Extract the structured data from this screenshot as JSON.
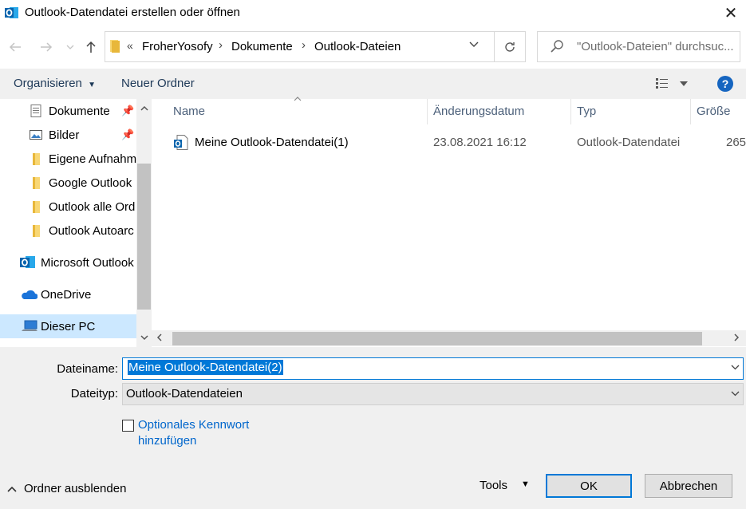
{
  "window": {
    "title": "Outlook-Datendatei erstellen oder öffnen",
    "close_glyph": "✕"
  },
  "address": {
    "overflow_chevron": "«",
    "breadcrumbs": [
      "FroherYosofy",
      "Dokumente",
      "Outlook-Dateien"
    ],
    "separator": "›",
    "search_placeholder": "\"Outlook-Dateien\" durchsuc..."
  },
  "toolbar": {
    "organize_label": "Organisieren",
    "new_folder_label": "Neuer Ordner",
    "help_label": "?"
  },
  "navpane": {
    "items": [
      {
        "label": "Dokumente",
        "icon": "documents-icon",
        "pinned": true
      },
      {
        "label": "Bilder",
        "icon": "pictures-icon",
        "pinned": true
      },
      {
        "label": "Eigene Aufnahm",
        "icon": "folder-icon",
        "pinned": false
      },
      {
        "label": "Google Outlook",
        "icon": "folder-icon",
        "pinned": false
      },
      {
        "label": "Outlook alle Ord",
        "icon": "folder-icon",
        "pinned": false
      },
      {
        "label": "Outlook Autoarc",
        "icon": "folder-icon",
        "pinned": false
      },
      {
        "label": "Microsoft Outlook",
        "icon": "outlook-icon",
        "pinned": false
      },
      {
        "label": "OneDrive",
        "icon": "onedrive-icon",
        "pinned": false
      },
      {
        "label": "Dieser PC",
        "icon": "pc-icon",
        "pinned": false,
        "selected": true
      }
    ]
  },
  "filelist": {
    "columns": [
      "Name",
      "Änderungsdatum",
      "Typ",
      "Größe"
    ],
    "rows": [
      {
        "name": "Meine Outlook-Datendatei(1)",
        "date": "23.08.2021 16:12",
        "type": "Outlook-Datendatei",
        "size": "265"
      }
    ]
  },
  "form": {
    "filename_label": "Dateiname:",
    "filename_value": "Meine Outlook-Datendatei(2)",
    "filetype_label": "Dateityp:",
    "filetype_value": "Outlook-Datendateien",
    "password_label": "Optionales Kennwort hinzufügen"
  },
  "footer": {
    "hide_folders_label": "Ordner ausblenden",
    "tools_label": "Tools",
    "ok_label": "OK",
    "cancel_label": "Abbrechen"
  },
  "colors": {
    "accent": "#0078d7",
    "selection": "#cce8ff",
    "help": "#1565c0",
    "link": "#0066cc"
  }
}
